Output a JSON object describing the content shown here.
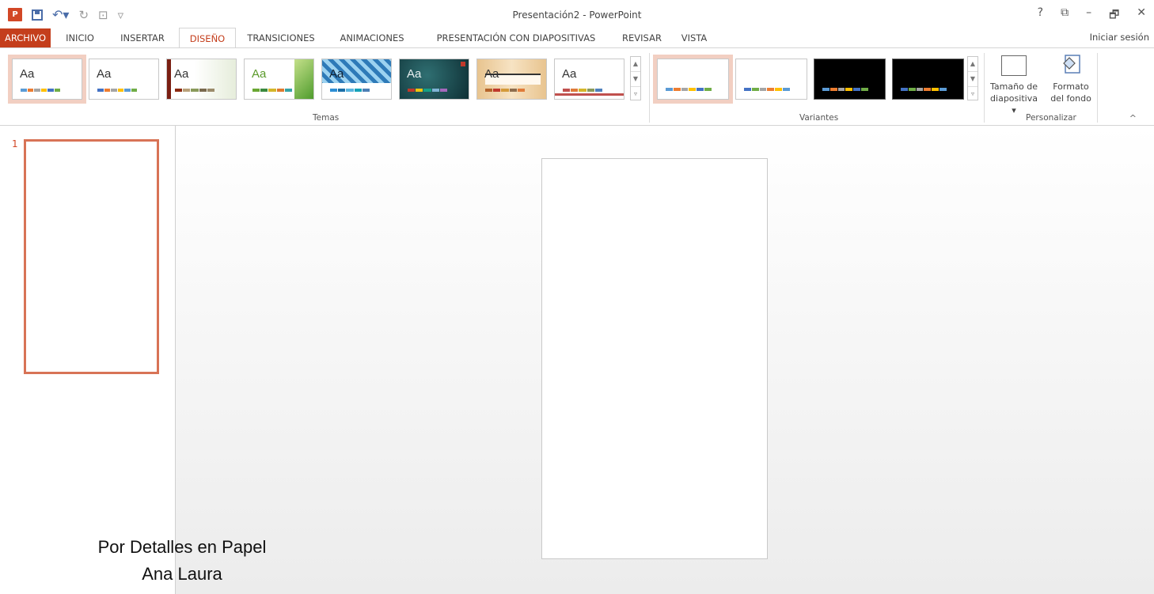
{
  "window": {
    "title": "Presentación2 - PowerPoint"
  },
  "quick_access": {
    "app_icon": "powerpoint-icon",
    "icons": [
      "save-icon",
      "undo-icon",
      "redo-icon",
      "start-from-beginning-icon",
      "customize-qat-icon"
    ]
  },
  "window_controls": {
    "help": "?",
    "ribbon_options": "⧉",
    "minimize": "–",
    "restore": "🗗",
    "close": "✕"
  },
  "tabs": [
    {
      "label": "ARCHIVO"
    },
    {
      "label": "INICIO"
    },
    {
      "label": "INSERTAR"
    },
    {
      "label": "DISEÑO"
    },
    {
      "label": "TRANSICIONES"
    },
    {
      "label": "ANIMACIONES"
    },
    {
      "label": "PRESENTACIÓN CON DIAPOSITIVAS"
    },
    {
      "label": "REVISAR"
    },
    {
      "label": "VISTA"
    }
  ],
  "active_tab": "DISEÑO",
  "signin": "Iniciar sesión",
  "ribbon": {
    "themes_group": "Temas",
    "variants_group": "Variantes",
    "customize_group": "Personalizar",
    "themes": [
      {
        "label": "Aa"
      },
      {
        "label": "Aa"
      },
      {
        "label": "Aa"
      },
      {
        "label": "Aa"
      },
      {
        "label": "Aa"
      },
      {
        "label": "Aa"
      },
      {
        "label": "Aa"
      },
      {
        "label": "Aa"
      }
    ],
    "slide_size": {
      "line1": "Tamaño de",
      "line2": "diapositiva ▾"
    },
    "background_format": {
      "line1": "Formato",
      "line2": "del fondo"
    },
    "collapse": "^"
  },
  "slides_pane": {
    "slide_number": "1"
  },
  "watermark": {
    "line1": "Por Detalles en Papel",
    "line2": "Ana Laura"
  },
  "colors": {
    "accent": "#c43e1c",
    "selection": "#d87356"
  }
}
